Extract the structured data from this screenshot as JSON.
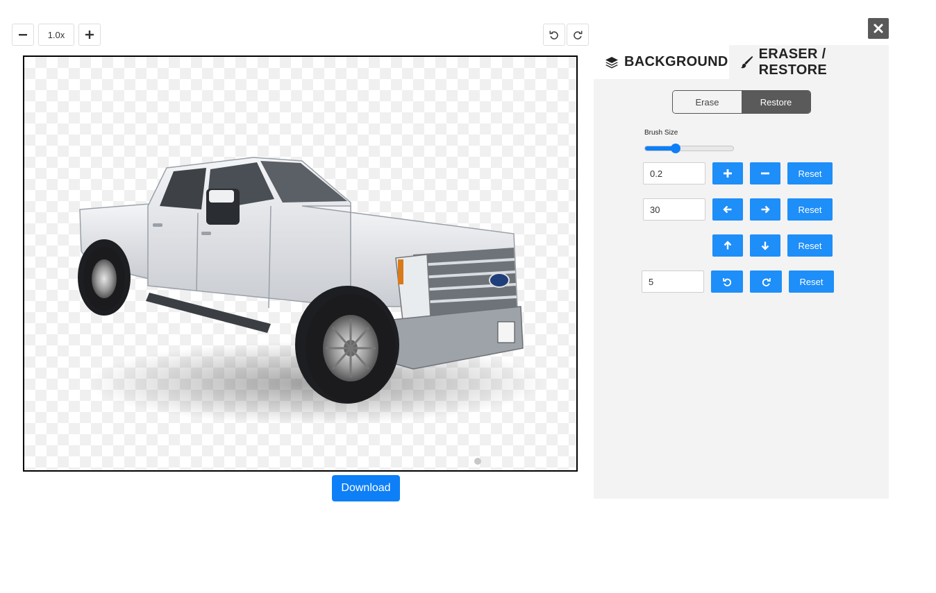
{
  "toolbar": {
    "zoom_value": "1.0x",
    "zoom_out_icon": "minus-icon",
    "zoom_in_icon": "plus-icon",
    "undo_icon": "undo-icon",
    "redo_icon": "redo-icon"
  },
  "canvas": {
    "subject": "white pickup truck with transparent background"
  },
  "download_label": "Download",
  "close_icon": "close-icon",
  "tabs": [
    {
      "label": "BACKGROUND",
      "icon": "layers-icon"
    },
    {
      "label": "ERASER / RESTORE",
      "icon": "brush-icon"
    }
  ],
  "eraser_panel": {
    "mode_options": [
      "Erase",
      "Restore"
    ],
    "selected_mode": "Restore",
    "brush_size_label": "Brush Size",
    "brush_size_level": 0.35,
    "scale": {
      "value": "0.2",
      "reset_label": "Reset"
    },
    "horizontal": {
      "value": "30",
      "reset_label": "Reset"
    },
    "vertical": {
      "reset_label": "Reset"
    },
    "rotate": {
      "value": "5",
      "reset_label": "Reset"
    }
  },
  "colors": {
    "accent": "#1e8ef8",
    "download": "#0d7ff7",
    "panel_bg": "#f3f3f3",
    "toggle_active": "#5a5a5a"
  }
}
